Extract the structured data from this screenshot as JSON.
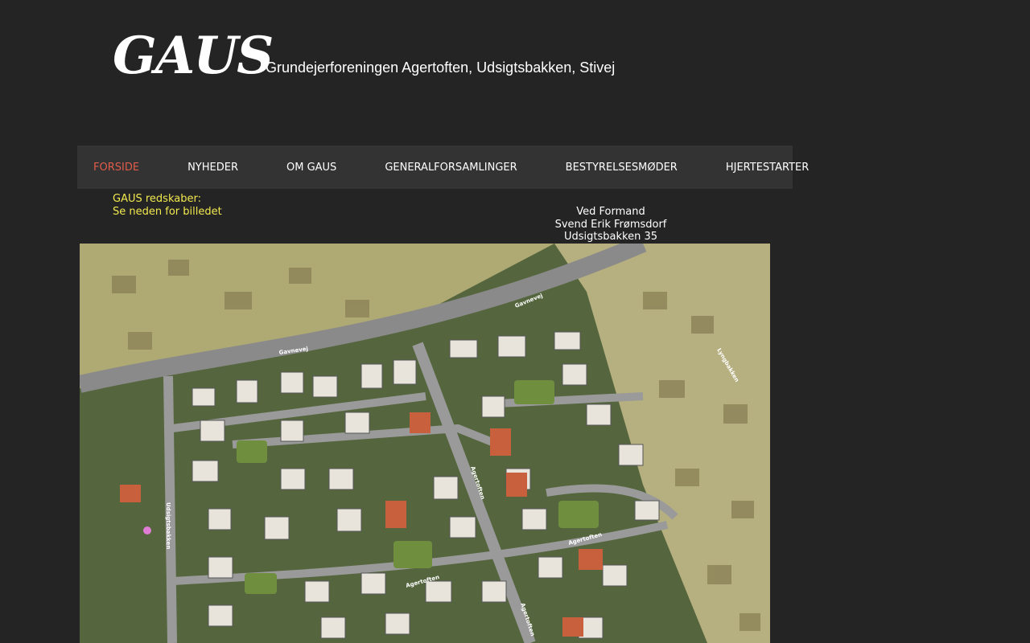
{
  "header": {
    "logo": "GAUS",
    "tagline": "Grundejerforeningen Agertoften, Udsigtsbakken, Stivej"
  },
  "nav": {
    "items": [
      {
        "label": "FORSIDE",
        "active": true
      },
      {
        "label": "NYHEDER",
        "active": false
      },
      {
        "label": "OM GAUS",
        "active": false
      },
      {
        "label": "GENERALFORSAMLINGER",
        "active": false
      },
      {
        "label": "BESTYRELSESMØDER",
        "active": false
      },
      {
        "label": "HJERTESTARTER",
        "active": false
      }
    ],
    "active_color": "#e05c4a"
  },
  "notice": {
    "line1": "GAUS redskaber:",
    "line2": "Se neden for billedet",
    "color": "#f2e94e"
  },
  "address": {
    "line1": "Ved Formand",
    "line2": "Svend Erik Frømsdorf",
    "line3": "Udsigtsbakken 35"
  },
  "map": {
    "street_labels": [
      "Gavnevej",
      "Gavnevej",
      "Lyngbakken",
      "Agertoften",
      "Agertoften",
      "Agertoften",
      "Agertoften",
      "Udsigtsbakken"
    ]
  }
}
